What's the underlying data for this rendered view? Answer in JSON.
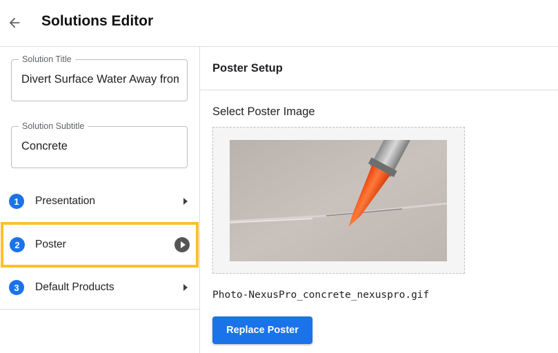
{
  "header": {
    "title": "Solutions Editor"
  },
  "sidebar": {
    "fields": [
      {
        "label": "Solution Title",
        "value": "Divert Surface Water Away from"
      },
      {
        "label": "Solution Subtitle",
        "value": "Concrete"
      }
    ],
    "steps": [
      {
        "number": "1",
        "label": "Presentation",
        "active": false
      },
      {
        "number": "2",
        "label": "Poster",
        "active": true
      },
      {
        "number": "3",
        "label": "Default Products",
        "active": false
      }
    ]
  },
  "main": {
    "section_title": "Poster Setup",
    "select_label": "Select Poster Image",
    "poster_image": "sealant-gun-on-concrete-photo",
    "filename": "Photo-NexusPro_concrete_nexuspro.gif",
    "replace_button": "Replace Poster"
  },
  "colors": {
    "accent": "#1a73e8",
    "highlight": "#fbc02d"
  }
}
